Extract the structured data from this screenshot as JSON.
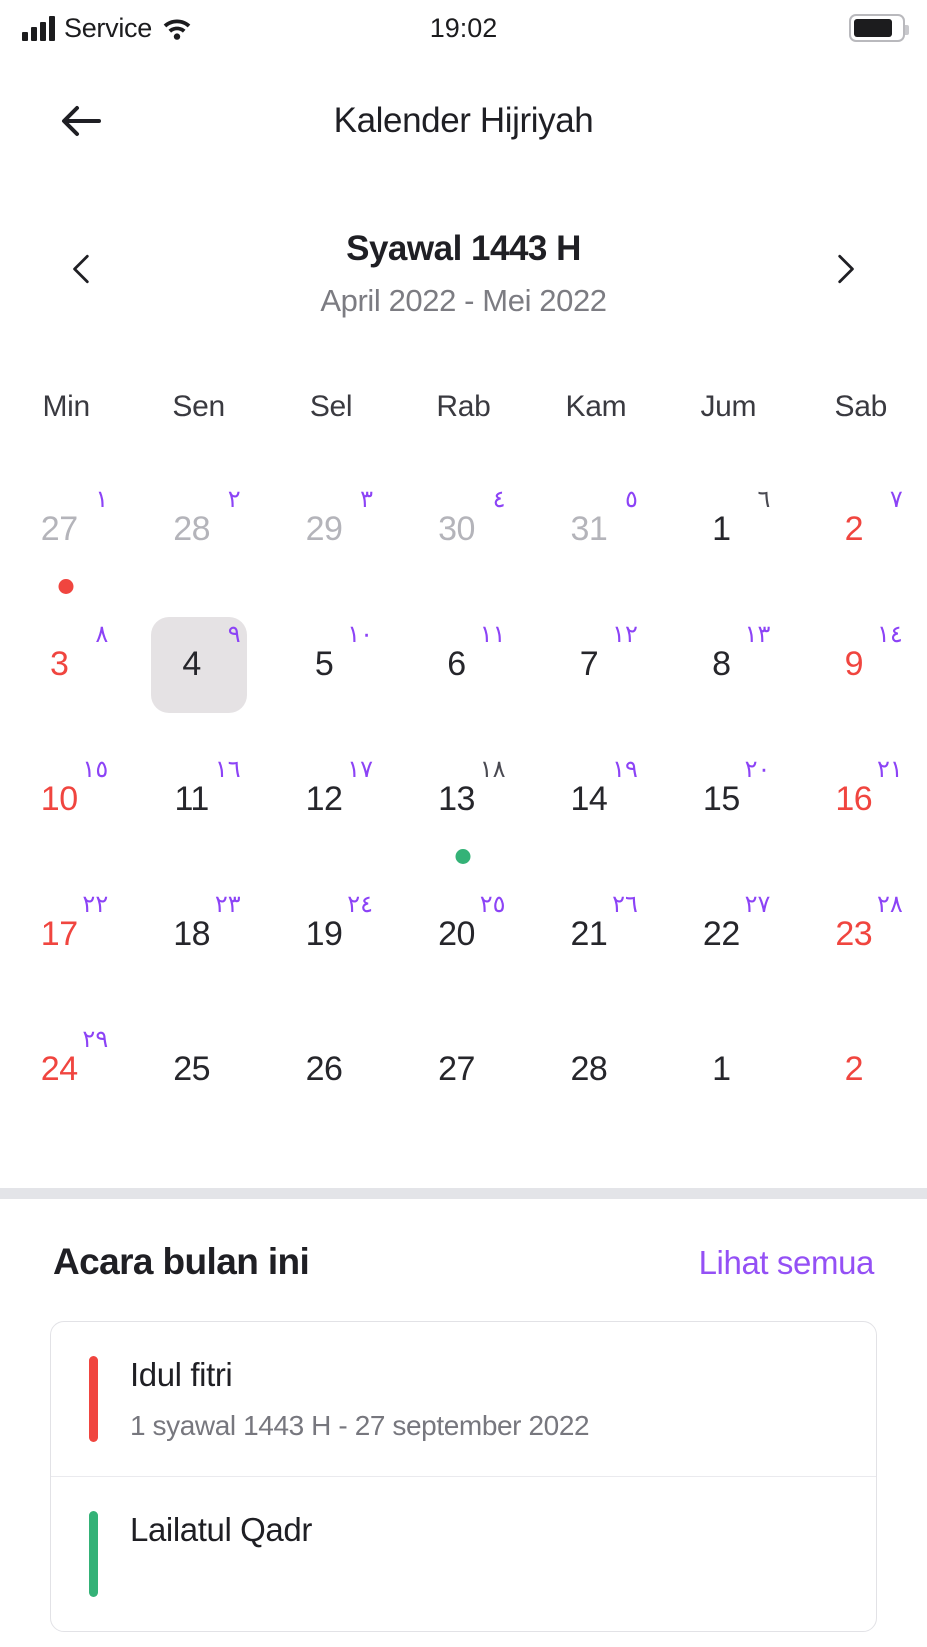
{
  "status_bar": {
    "carrier": "Service",
    "time": "19:02",
    "signal_icon": "signal-bars-icon",
    "wifi_icon": "wifi-icon",
    "battery_icon": "battery-icon"
  },
  "app_bar": {
    "back_icon": "back-arrow-icon",
    "title": "Kalender Hijriyah"
  },
  "month_header": {
    "prev_icon": "chevron-left-icon",
    "next_icon": "chevron-right-icon",
    "title": "Syawal 1443 H",
    "subtitle": "April 2022 - Mei 2022"
  },
  "colors": {
    "hijri_purple": "#8c43f6",
    "weekend_red": "#f0453f",
    "muted_gray": "#b4b4ba",
    "selected_bg": "#e5e2e4",
    "link_purple": "#9450f5",
    "event_red": "#f0453f",
    "event_green": "#34b277",
    "dot_red": "#f0453f",
    "dot_green": "#34b277"
  },
  "weekdays": [
    "Min",
    "Sen",
    "Sel",
    "Rab",
    "Kam",
    "Jum",
    "Sab"
  ],
  "days": [
    {
      "greg": "27",
      "hijri": "١",
      "state": "muted",
      "hijri_style": "purple",
      "selected": false,
      "dot": "red"
    },
    {
      "greg": "28",
      "hijri": "٢",
      "state": "muted",
      "hijri_style": "purple",
      "selected": false,
      "dot": ""
    },
    {
      "greg": "29",
      "hijri": "٣",
      "state": "muted",
      "hijri_style": "purple",
      "selected": false,
      "dot": ""
    },
    {
      "greg": "30",
      "hijri": "٤",
      "state": "muted",
      "hijri_style": "purple",
      "selected": false,
      "dot": ""
    },
    {
      "greg": "31",
      "hijri": "٥",
      "state": "muted",
      "hijri_style": "purple",
      "selected": false,
      "dot": ""
    },
    {
      "greg": "1",
      "hijri": "٦",
      "state": "normal",
      "hijri_style": "dark",
      "selected": false,
      "dot": ""
    },
    {
      "greg": "2",
      "hijri": "٧",
      "state": "weekend",
      "hijri_style": "purple",
      "selected": false,
      "dot": ""
    },
    {
      "greg": "3",
      "hijri": "٨",
      "state": "weekend",
      "hijri_style": "purple",
      "selected": false,
      "dot": ""
    },
    {
      "greg": "4",
      "hijri": "٩",
      "state": "normal",
      "hijri_style": "purple",
      "selected": true,
      "dot": ""
    },
    {
      "greg": "5",
      "hijri": "١٠",
      "state": "normal",
      "hijri_style": "purple",
      "selected": false,
      "dot": ""
    },
    {
      "greg": "6",
      "hijri": "١١",
      "state": "normal",
      "hijri_style": "purple",
      "selected": false,
      "dot": ""
    },
    {
      "greg": "7",
      "hijri": "١٢",
      "state": "normal",
      "hijri_style": "purple",
      "selected": false,
      "dot": ""
    },
    {
      "greg": "8",
      "hijri": "١٣",
      "state": "normal",
      "hijri_style": "purple",
      "selected": false,
      "dot": ""
    },
    {
      "greg": "9",
      "hijri": "١٤",
      "state": "weekend",
      "hijri_style": "purple",
      "selected": false,
      "dot": ""
    },
    {
      "greg": "10",
      "hijri": "١٥",
      "state": "weekend",
      "hijri_style": "purple",
      "selected": false,
      "dot": ""
    },
    {
      "greg": "11",
      "hijri": "١٦",
      "state": "normal",
      "hijri_style": "purple",
      "selected": false,
      "dot": ""
    },
    {
      "greg": "12",
      "hijri": "١٧",
      "state": "normal",
      "hijri_style": "purple",
      "selected": false,
      "dot": ""
    },
    {
      "greg": "13",
      "hijri": "١٨",
      "state": "normal",
      "hijri_style": "dark",
      "selected": false,
      "dot": "green"
    },
    {
      "greg": "14",
      "hijri": "١٩",
      "state": "normal",
      "hijri_style": "purple",
      "selected": false,
      "dot": ""
    },
    {
      "greg": "15",
      "hijri": "٢٠",
      "state": "normal",
      "hijri_style": "purple",
      "selected": false,
      "dot": ""
    },
    {
      "greg": "16",
      "hijri": "٢١",
      "state": "weekend",
      "hijri_style": "purple",
      "selected": false,
      "dot": ""
    },
    {
      "greg": "17",
      "hijri": "٢٢",
      "state": "weekend",
      "hijri_style": "purple",
      "selected": false,
      "dot": ""
    },
    {
      "greg": "18",
      "hijri": "٢٣",
      "state": "normal",
      "hijri_style": "purple",
      "selected": false,
      "dot": ""
    },
    {
      "greg": "19",
      "hijri": "٢٤",
      "state": "normal",
      "hijri_style": "purple",
      "selected": false,
      "dot": ""
    },
    {
      "greg": "20",
      "hijri": "٢٥",
      "state": "normal",
      "hijri_style": "purple",
      "selected": false,
      "dot": ""
    },
    {
      "greg": "21",
      "hijri": "٢٦",
      "state": "normal",
      "hijri_style": "purple",
      "selected": false,
      "dot": ""
    },
    {
      "greg": "22",
      "hijri": "٢٧",
      "state": "normal",
      "hijri_style": "purple",
      "selected": false,
      "dot": ""
    },
    {
      "greg": "23",
      "hijri": "٢٨",
      "state": "weekend",
      "hijri_style": "purple",
      "selected": false,
      "dot": ""
    },
    {
      "greg": "24",
      "hijri": "٢٩",
      "state": "weekend",
      "hijri_style": "purple",
      "selected": false,
      "dot": ""
    },
    {
      "greg": "25",
      "hijri": "",
      "state": "normal",
      "hijri_style": "purple",
      "selected": false,
      "dot": ""
    },
    {
      "greg": "26",
      "hijri": "",
      "state": "normal",
      "hijri_style": "purple",
      "selected": false,
      "dot": ""
    },
    {
      "greg": "27",
      "hijri": "",
      "state": "normal",
      "hijri_style": "purple",
      "selected": false,
      "dot": ""
    },
    {
      "greg": "28",
      "hijri": "",
      "state": "normal",
      "hijri_style": "purple",
      "selected": false,
      "dot": ""
    },
    {
      "greg": "1",
      "hijri": "",
      "state": "normal",
      "hijri_style": "purple",
      "selected": false,
      "dot": ""
    },
    {
      "greg": "2",
      "hijri": "",
      "state": "weekend",
      "hijri_style": "purple",
      "selected": false,
      "dot": ""
    }
  ],
  "events_section": {
    "title": "Acara bulan ini",
    "link_label": "Lihat semua",
    "items": [
      {
        "name": "Idul fitri",
        "meta": "1 syawal 1443 H - 27 september 2022",
        "color": "#f0453f"
      },
      {
        "name": "Lailatul Qadr",
        "meta": "",
        "color": "#34b277"
      }
    ]
  }
}
